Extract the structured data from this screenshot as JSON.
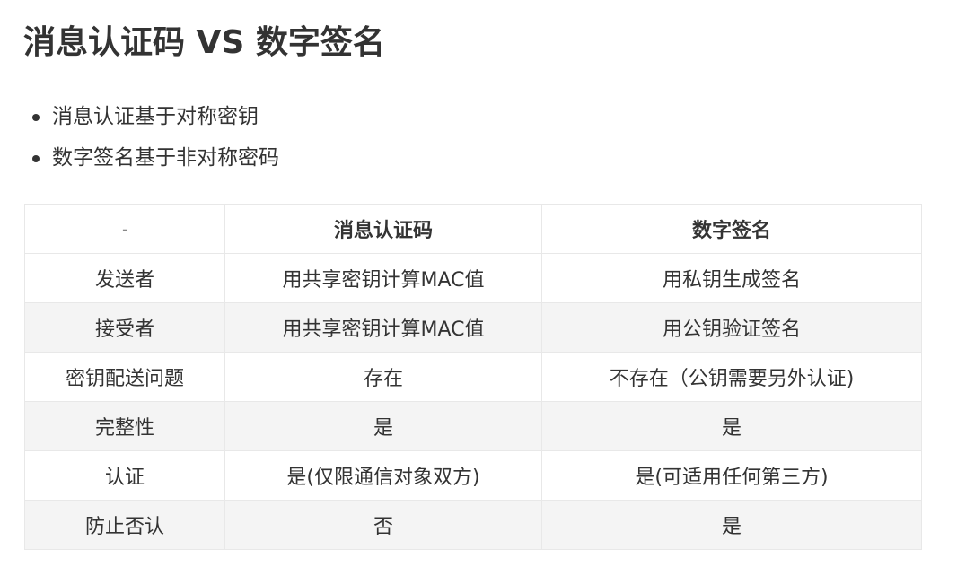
{
  "title": "消息认证码 VS 数字签名",
  "bullets": [
    "消息认证基于对称密钥",
    "数字签名基于非对称密码"
  ],
  "table": {
    "headers": [
      "-",
      "消息认证码",
      "数字签名"
    ],
    "rows": [
      [
        "发送者",
        "用共享密钥计算MAC值",
        "用私钥生成签名"
      ],
      [
        "接受者",
        "用共享密钥计算MAC值",
        "用公钥验证签名"
      ],
      [
        "密钥配送问题",
        "存在",
        "不存在（公钥需要另外认证)"
      ],
      [
        "完整性",
        "是",
        "是"
      ],
      [
        "认证",
        "是(仅限通信对象双方)",
        "是(可适用任何第三方)"
      ],
      [
        "防止否认",
        "否",
        "是"
      ]
    ]
  }
}
